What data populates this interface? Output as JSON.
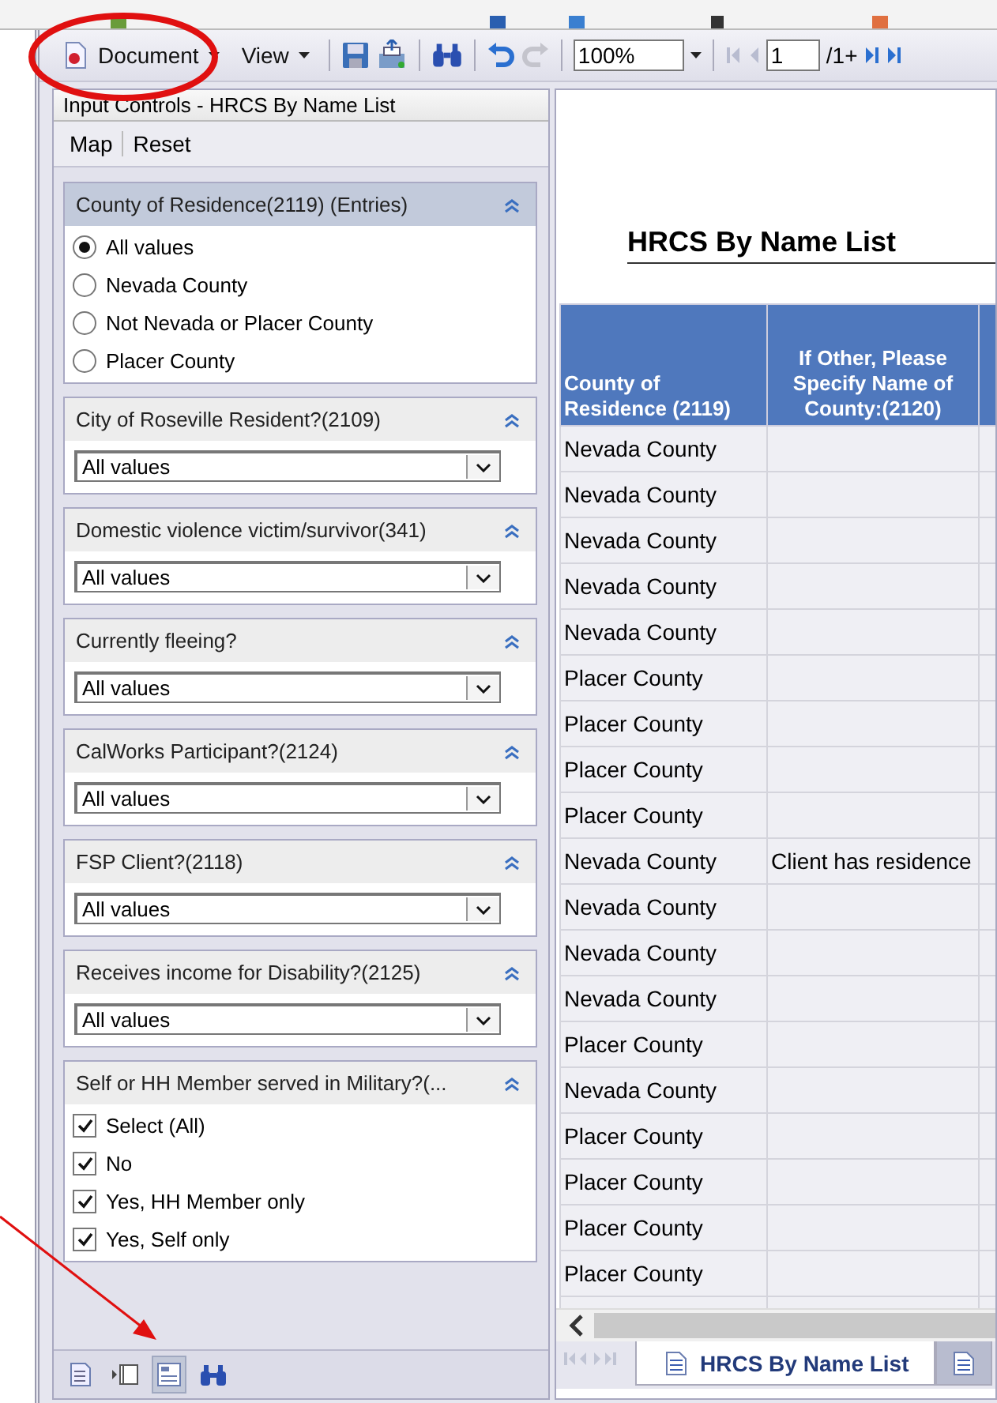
{
  "toolbar": {
    "menus": [
      {
        "label": "Document"
      },
      {
        "label": "View"
      }
    ],
    "zoom": "100%",
    "page": "1",
    "page_total": "/1+"
  },
  "input_panel": {
    "title": "Input Controls - HRCS By Name List",
    "actions": [
      "Map",
      "Reset"
    ],
    "filters": [
      {
        "kind": "radio",
        "title": "County of Residence(2119) (Entries)",
        "highlighted": true,
        "options": [
          {
            "label": "All values",
            "selected": true
          },
          {
            "label": "Nevada County",
            "selected": false
          },
          {
            "label": "Not Nevada or Placer County",
            "selected": false
          },
          {
            "label": "Placer County",
            "selected": false
          }
        ]
      },
      {
        "kind": "select",
        "title": "City of Roseville Resident?(2109)",
        "highlighted": false,
        "value": "All values"
      },
      {
        "kind": "select",
        "title": "Domestic violence victim/survivor(341)",
        "highlighted": false,
        "value": "All values"
      },
      {
        "kind": "select",
        "title": "Currently fleeing?",
        "highlighted": false,
        "value": "All values"
      },
      {
        "kind": "select",
        "title": "CalWorks Participant?(2124)",
        "highlighted": false,
        "value": "All values"
      },
      {
        "kind": "select",
        "title": "FSP Client?(2118)",
        "highlighted": false,
        "value": "All values"
      },
      {
        "kind": "select",
        "title": "Receives income for Disability?(2125)",
        "highlighted": false,
        "value": "All values"
      },
      {
        "kind": "checkbox",
        "title": "Self or HH Member served in Military?(...",
        "highlighted": false,
        "options": [
          {
            "label": "Select (All)",
            "checked": true
          },
          {
            "label": "No",
            "checked": true
          },
          {
            "label": "Yes, HH Member only",
            "checked": true
          },
          {
            "label": "Yes, Self only",
            "checked": true
          }
        ]
      }
    ],
    "footer_tools": [
      {
        "selected": false
      },
      {
        "selected": false
      },
      {
        "selected": true
      },
      {
        "selected": false
      }
    ]
  },
  "report": {
    "title": "HRCS By Name List",
    "table": {
      "columns": [
        "County of Residence (2119)",
        "If Other, Please Specify Name of County:(2120)"
      ],
      "rows": [
        [
          "Nevada County",
          ""
        ],
        [
          "Nevada County",
          ""
        ],
        [
          "Nevada County",
          ""
        ],
        [
          "Nevada County",
          ""
        ],
        [
          "Nevada County",
          ""
        ],
        [
          "Placer County",
          ""
        ],
        [
          "Placer County",
          ""
        ],
        [
          "Placer County",
          ""
        ],
        [
          "Placer County",
          ""
        ],
        [
          "Nevada County",
          "Client has residence"
        ],
        [
          "Nevada County",
          ""
        ],
        [
          "Nevada County",
          ""
        ],
        [
          "Nevada County",
          ""
        ],
        [
          "Placer County",
          ""
        ],
        [
          "Nevada County",
          ""
        ],
        [
          "Placer County",
          ""
        ],
        [
          "Placer County",
          ""
        ],
        [
          "Placer County",
          ""
        ],
        [
          "Placer County",
          ""
        ]
      ]
    },
    "sheet_tabs": [
      {
        "label": "HRCS By Name List",
        "selected": true
      },
      {
        "selected": false
      }
    ]
  }
}
